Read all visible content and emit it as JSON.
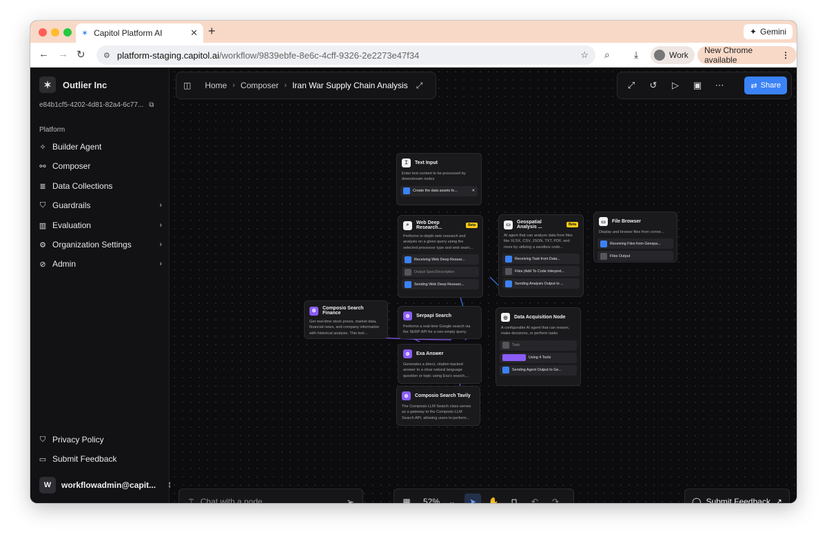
{
  "browser": {
    "tab_title": "Capitol Platform AI",
    "url_host": "platform-staging.capitol.ai",
    "url_path": "/workflow/9839ebfe-8e6c-4cff-9326-2e2273e47f34",
    "gemini_label": "Gemini",
    "profile_label": "Work",
    "update_label": "New Chrome available"
  },
  "sidebar": {
    "org_name": "Outlier Inc",
    "org_id": "e84b1cf5-4202-4d81-82a4-6c77...",
    "section_label": "Platform",
    "items": [
      {
        "label": "Builder Agent",
        "icon": "sparkle-icon",
        "chevron": false
      },
      {
        "label": "Composer",
        "icon": "nodes-icon",
        "chevron": false
      },
      {
        "label": "Data Collections",
        "icon": "database-icon",
        "chevron": false
      },
      {
        "label": "Guardrails",
        "icon": "shield-icon",
        "chevron": true
      },
      {
        "label": "Evaluation",
        "icon": "chart-icon",
        "chevron": true
      },
      {
        "label": "Organization Settings",
        "icon": "gear-icon",
        "chevron": true
      },
      {
        "label": "Admin",
        "icon": "shield-off-icon",
        "chevron": true
      }
    ],
    "footer": [
      {
        "label": "Privacy Policy",
        "icon": "shield-check-icon"
      },
      {
        "label": "Submit Feedback",
        "icon": "message-icon"
      }
    ],
    "user_initial": "W",
    "user_email": "workflowadmin@capit..."
  },
  "canvas": {
    "breadcrumbs": [
      "Home",
      "Composer",
      "Iran War Supply Chain Analysis"
    ],
    "share_label": "Share",
    "chat_placeholder": "Chat with a node",
    "zoom_label": "52%",
    "feedback_label": "Submit Feedback"
  },
  "nodes": {
    "text_input": {
      "title": "Text Input",
      "desc": "Enter text content to be processed by downstream nodes",
      "row": "Create the data assets fo..."
    },
    "web_research": {
      "title": "Web Deep Research...",
      "badge": "Beta",
      "desc": "Performs in-depth web research and analysis on a given query using the selected processor type and web searc...",
      "rows": [
        "Receiving Web Deep Resear...",
        "Output Spec/Description",
        "Sending Web Deep Researc..."
      ]
    },
    "geospatial": {
      "title": "Geospatial Analysis ...",
      "badge": "Beta",
      "desc": "AI agent that can analyze data from files like XLSX, CSV, JSON, TXT, PDF, and more by utilizing a sandbox code...",
      "rows": [
        "Receiving Task from Data...",
        "Files (Add To Code Interpret...",
        "Sending Analysis Output to ..."
      ]
    },
    "file_browser": {
      "title": "File Browser",
      "desc": "Display and browse files from conne...",
      "rows": [
        "Receiving Files from Geospa...",
        "Files Output"
      ]
    },
    "search_finance": {
      "title": "Composio Search Finance",
      "desc": "Get real-time stock prices, market data, financial news, and company information with historical analysis. This tool..."
    },
    "serpapi": {
      "title": "Serpapi Search",
      "desc": "Performs a real-time Google search via the SERP API for a non-empty query."
    },
    "exa": {
      "title": "Exa Answer",
      "desc": "Generates a direct, citation-backed answer to a clear natural language question or topic using Exa's search,..."
    },
    "tavily": {
      "title": "Composio Search Tavily",
      "desc": "The Composio LLM Search class serves as a gateway to the Composio LLM Search API, allowing users to perform..."
    },
    "data_acq": {
      "title": "Data Acquisition Node",
      "desc": "A configurable AI agent that can reason, make decisions, or perform tasks",
      "rows": [
        "Task",
        "Using 4 Tools",
        "Sending Agent Output to Ge..."
      ]
    }
  }
}
